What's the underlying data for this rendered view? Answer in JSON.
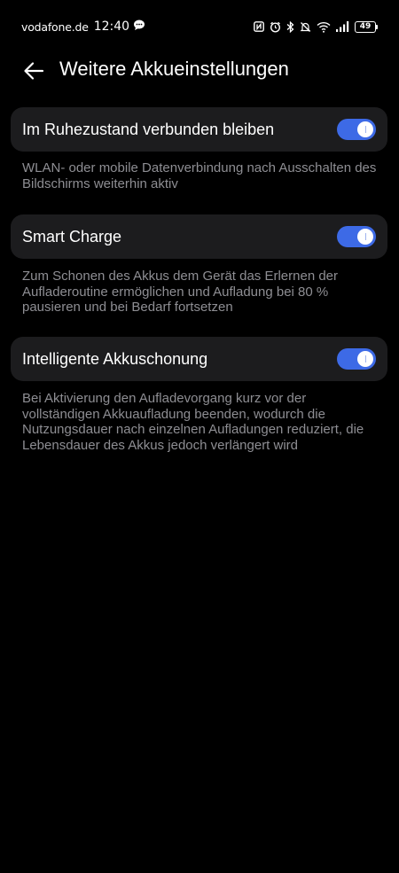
{
  "status_bar": {
    "carrier": "vodafone.de",
    "time": "12:40",
    "battery_level": "49",
    "icons": [
      "chat-bubble-icon",
      "nfc-icon",
      "alarm-icon",
      "bluetooth-icon",
      "mute-icon",
      "wifi-icon",
      "signal-icon",
      "battery-icon"
    ]
  },
  "header": {
    "title": "Weitere Akkueinstellungen"
  },
  "settings": [
    {
      "label": "Im Ruhezustand verbunden bleiben",
      "enabled": true,
      "description": "WLAN- oder mobile Datenverbindung nach Ausschalten des Bildschirms weiterhin aktiv"
    },
    {
      "label": "Smart Charge",
      "enabled": true,
      "description": "Zum Schonen des Akkus dem Gerät das Erlernen der Aufladeroutine ermöglichen und Aufladung bei 80 % pausieren und bei Bedarf fortsetzen"
    },
    {
      "label": "Intelligente Akkuschonung",
      "enabled": true,
      "description": "Bei Aktivierung den Aufladevorgang kurz vor der vollständigen Akkuaufladung beenden, wodurch die Nutzungsdauer nach einzelnen Aufladungen reduziert, die Lebensdauer des Akkus jedoch verlängert wird"
    }
  ],
  "colors": {
    "background": "#000000",
    "card": "#1c1c1e",
    "toggle_on": "#3d6ae6",
    "description_text": "#8e8e93"
  }
}
